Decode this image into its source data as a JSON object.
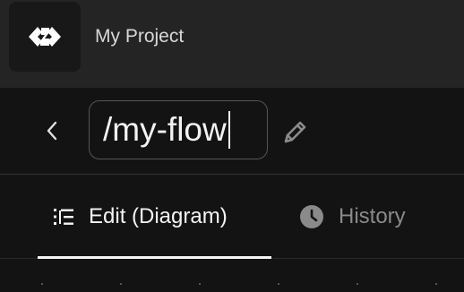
{
  "project": {
    "name": "My Project"
  },
  "flow": {
    "name": "/my-flow"
  },
  "tabs": [
    {
      "label": "Edit (Diagram)",
      "active": true
    },
    {
      "label": "History",
      "active": false
    }
  ],
  "colors": {
    "topbar_bg": "#242424",
    "page_bg": "#131313",
    "active_text": "#f4f4f4",
    "inactive_text": "#8a8a8a"
  },
  "icons": {
    "logo": "brand-logo-icon",
    "back": "chevron-left-icon",
    "edit": "pencil-icon",
    "edit_tab": "list-tree-icon",
    "history_tab": "clock-icon"
  }
}
